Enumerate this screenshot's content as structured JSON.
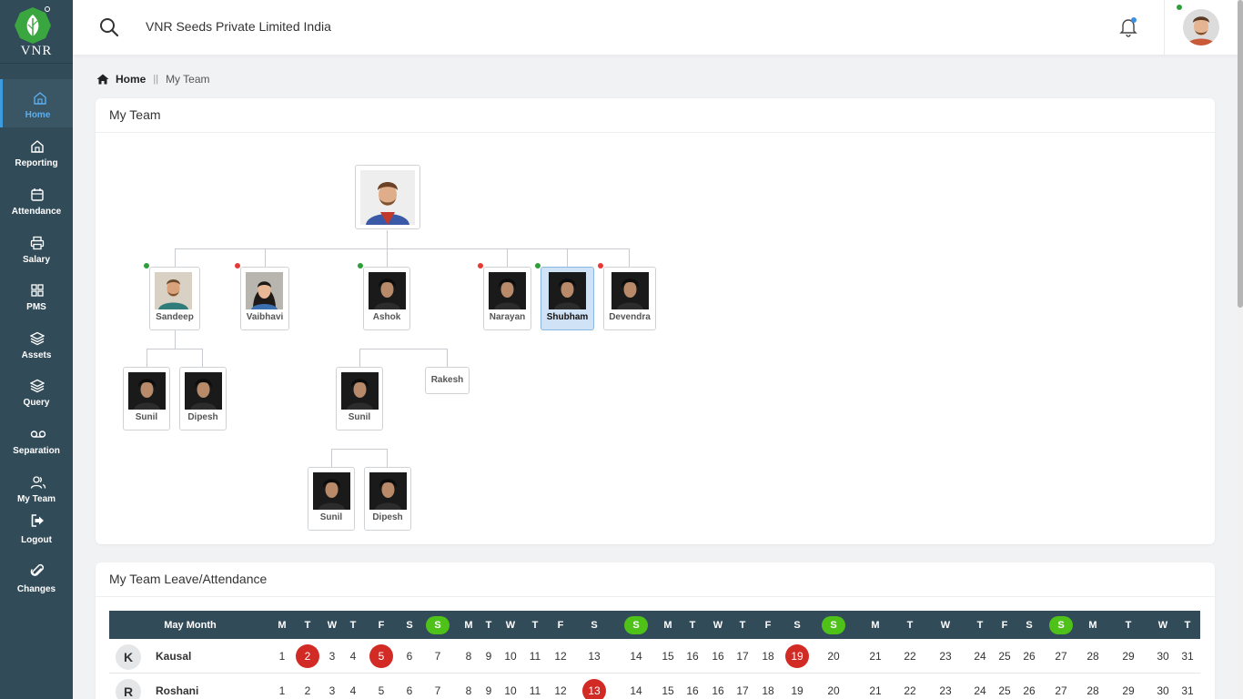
{
  "app": {
    "company": "VNR Seeds Private Limited India",
    "logo_text": "VNR",
    "accent": "#3f9be0",
    "sidebar_bg": "#324b58"
  },
  "sidebar": {
    "items": [
      {
        "label": "Home",
        "icon": "home-icon",
        "active": true
      },
      {
        "label": "Reporting",
        "icon": "home-icon"
      },
      {
        "label": "Attendance",
        "icon": "calendar-icon"
      },
      {
        "label": "Salary",
        "icon": "printer-icon"
      },
      {
        "label": "PMS",
        "icon": "grid-icon"
      },
      {
        "label": "Assets",
        "icon": "layers-icon"
      },
      {
        "label": "Query",
        "icon": "layers-icon"
      },
      {
        "label": "Separation",
        "icon": "voicemail-icon"
      },
      {
        "label": "My Team",
        "icon": "users-icon"
      },
      {
        "label": "Logout",
        "icon": "logout-icon"
      },
      {
        "label": "Changes",
        "icon": "paperclip-icon"
      }
    ]
  },
  "breadcrumb": {
    "home": "Home",
    "separator": "||",
    "current": "My Team"
  },
  "team_card": {
    "title": "My Team",
    "nodes": [
      {
        "name": "Sandeep",
        "status": "online",
        "photo": "man-beard"
      },
      {
        "name": "Vaibhavi",
        "status": "offline",
        "photo": "woman"
      },
      {
        "name": "Ashok",
        "status": "online",
        "photo": "man-dark"
      },
      {
        "name": "Narayan",
        "status": "offline",
        "photo": "man-dark"
      },
      {
        "name": "Shubham",
        "status": "online",
        "photo": "man-dark",
        "selected": true
      },
      {
        "name": "Devendra",
        "status": "offline",
        "photo": "man-dark"
      },
      {
        "name": "Sunil",
        "photo": "man-dark"
      },
      {
        "name": "Dipesh",
        "photo": "man-dark"
      },
      {
        "name": "Sunil",
        "photo": "man-dark"
      },
      {
        "name": "Rakesh",
        "photo": "none"
      },
      {
        "name": "Sunil",
        "photo": "man-dark"
      },
      {
        "name": "Dipesh",
        "photo": "man-dark"
      }
    ]
  },
  "attendance_card": {
    "title": "My Team Leave/Attendance",
    "month_label": "May Month",
    "days": [
      "M",
      "T",
      "W",
      "T",
      "F",
      "S",
      "S",
      "M",
      "T",
      "W",
      "T",
      "F",
      "S",
      "S",
      "M",
      "T",
      "W",
      "T",
      "F",
      "S",
      "S",
      "M",
      "T",
      "W",
      "T",
      "F",
      "S",
      "S",
      "M",
      "T",
      "W",
      "T"
    ],
    "sunday_indices": [
      6,
      13,
      20,
      27
    ],
    "rows": [
      {
        "initial": "K",
        "name": "Kausal",
        "dates": [
          "1",
          "2",
          "3",
          "4",
          "5",
          "6",
          "7",
          "8",
          "9",
          "10",
          "11",
          "12",
          "13",
          "14",
          "15",
          "16",
          "16",
          "17",
          "18",
          "19",
          "20",
          "21",
          "22",
          "23",
          "24",
          "25",
          "26",
          "27",
          "28",
          "29",
          "30",
          "31"
        ],
        "leave_indices": [
          1,
          4,
          19
        ]
      },
      {
        "initial": "R",
        "name": "Roshani",
        "dates": [
          "1",
          "2",
          "3",
          "4",
          "5",
          "6",
          "7",
          "8",
          "9",
          "10",
          "11",
          "12",
          "13",
          "14",
          "15",
          "16",
          "16",
          "17",
          "18",
          "19",
          "20",
          "21",
          "22",
          "23",
          "24",
          "25",
          "26",
          "27",
          "28",
          "29",
          "30",
          "31"
        ],
        "leave_indices": [
          12
        ]
      }
    ]
  },
  "status_colors": {
    "online": "#2e9e3b",
    "offline": "#e53935",
    "sunday": "#4fc21a",
    "leave": "#d22b26"
  }
}
